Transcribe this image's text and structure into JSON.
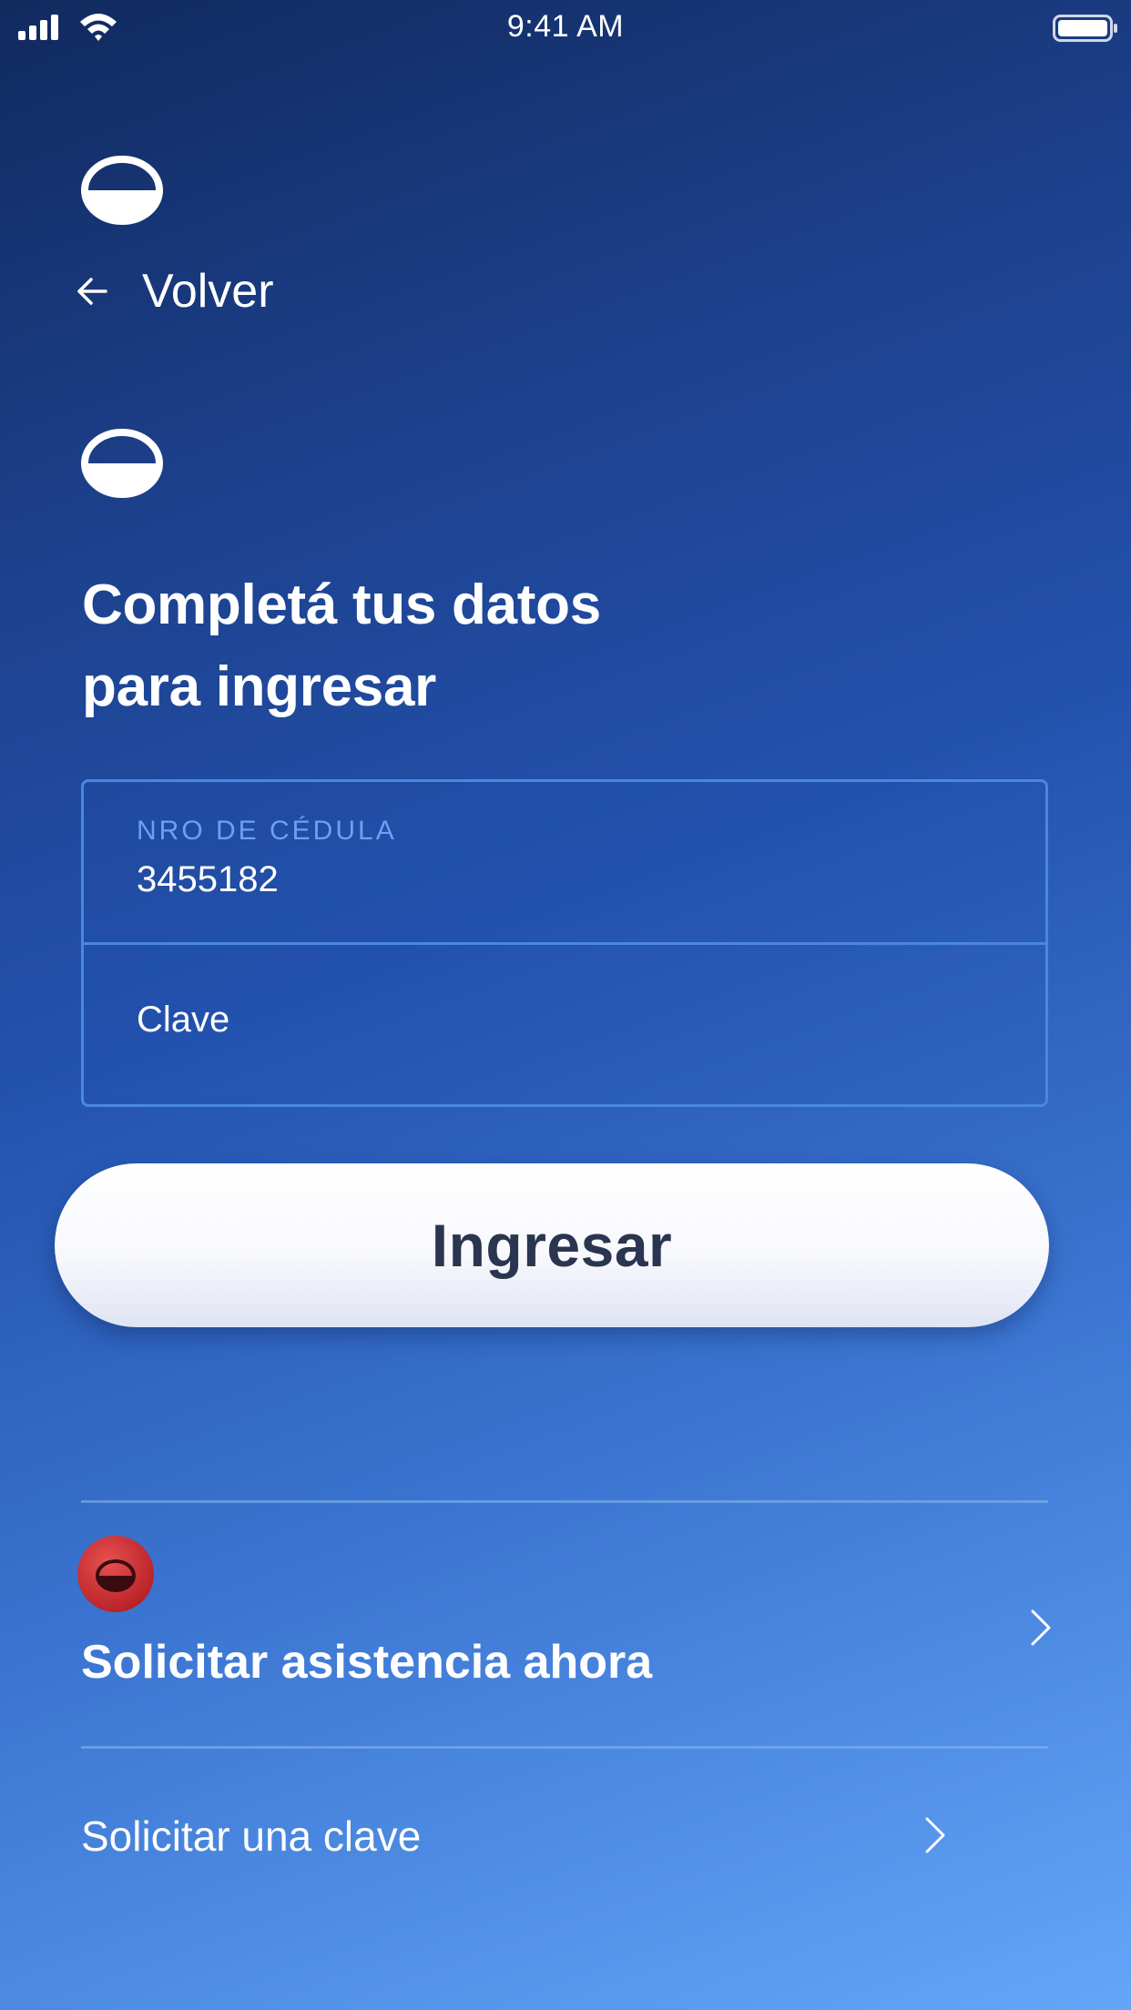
{
  "status_bar": {
    "time": "9:41 AM"
  },
  "header": {
    "back_label": "Volver"
  },
  "main": {
    "title_line1": "Completá tus datos",
    "title_line2": "para ingresar",
    "form": {
      "id_label": "NRO DE CÉDULA",
      "id_value": "3455182",
      "password_placeholder": "Clave"
    },
    "submit_label": "Ingresar"
  },
  "options": [
    {
      "label": "Solicitar asistencia ahora"
    },
    {
      "label": "Solicitar una clave"
    }
  ],
  "colors": {
    "background_top": "#112a5e",
    "background_bottom": "#63a6f8",
    "field_border": "#4a87e0",
    "field_label": "#6aa2ef",
    "button_text": "#2a3550",
    "assist_icon": "#d22f2f"
  },
  "icons": {
    "signal": "cellular-signal-icon",
    "wifi": "wifi-icon",
    "battery": "battery-icon",
    "logo": "brand-logo-icon",
    "back": "arrow-left-icon",
    "assist": "assistance-icon",
    "chevron": "chevron-right-icon"
  }
}
